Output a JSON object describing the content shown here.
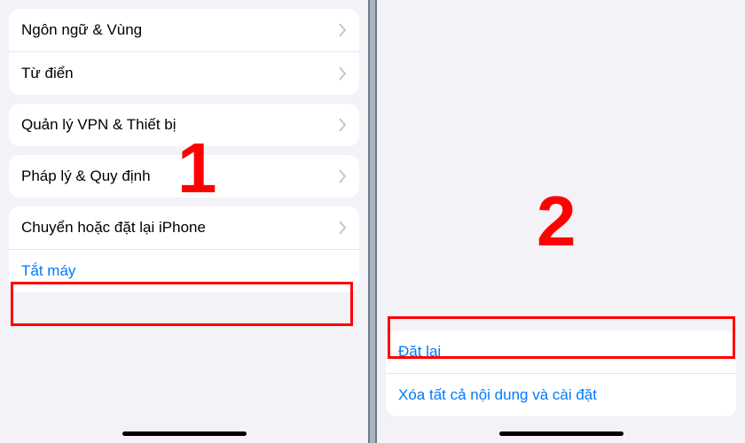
{
  "left": {
    "stepNumber": "1",
    "group1": {
      "languageRegion": "Ngôn ngữ & Vùng",
      "dictionary": "Từ điển"
    },
    "group2": {
      "vpnDevice": "Quản lý VPN & Thiết bị"
    },
    "group3": {
      "legal": "Pháp lý & Quy định"
    },
    "group4": {
      "transferReset": "Chuyển hoặc đặt lại iPhone",
      "shutdown": "Tắt máy"
    }
  },
  "right": {
    "stepNumber": "2",
    "reset": "Đặt lại",
    "eraseAll": "Xóa tất cả nội dung và cài đặt"
  }
}
